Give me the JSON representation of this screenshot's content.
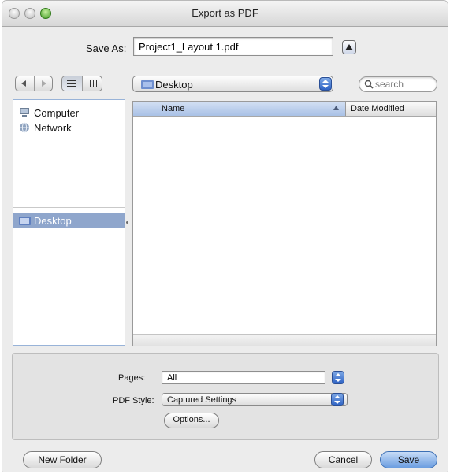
{
  "window": {
    "title": "Export as PDF"
  },
  "save_as": {
    "label": "Save As:",
    "value": "Project1_Layout 1.pdf"
  },
  "location": {
    "current": "Desktop"
  },
  "search": {
    "placeholder": "search"
  },
  "sidebar": {
    "devices": [
      {
        "label": "Computer",
        "icon": "computer-icon"
      },
      {
        "label": "Network",
        "icon": "network-icon"
      }
    ],
    "places": [
      {
        "label": "Desktop",
        "icon": "desktop-folder-icon",
        "selected": true
      }
    ]
  },
  "file_list": {
    "columns": [
      {
        "label": "Name",
        "sorted": true
      },
      {
        "label": "Date Modified"
      }
    ],
    "rows": []
  },
  "options_panel": {
    "pages_label": "Pages:",
    "pages_value": "All",
    "pdf_style_label": "PDF Style:",
    "pdf_style_value": "Captured Settings",
    "options_button": "Options..."
  },
  "footer": {
    "new_folder": "New Folder",
    "cancel": "Cancel",
    "save": "Save"
  },
  "colors": {
    "selection": "#8fa6cc",
    "default_button": "#6b9de0",
    "zoom_button": "#3f9a22"
  }
}
